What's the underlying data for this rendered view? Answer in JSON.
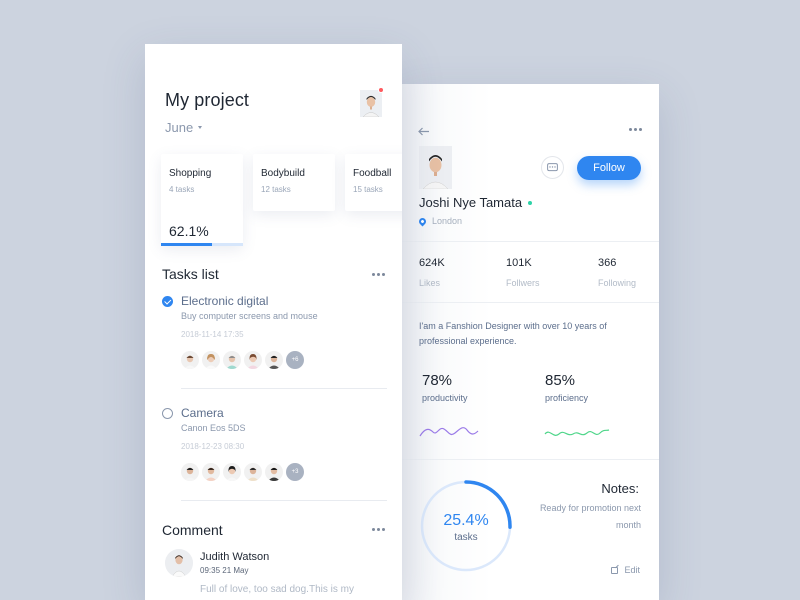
{
  "project": {
    "title": "My project",
    "month": "June",
    "notification_color": "#ff5a5f"
  },
  "categories": [
    {
      "name": "Shopping",
      "count": "4 tasks",
      "percent_label": "62.1%",
      "progress": 0.621
    },
    {
      "name": "Bodybuild",
      "count": "12 tasks"
    },
    {
      "name": "Foodball",
      "count": "15 tasks"
    }
  ],
  "tasks_section": {
    "title": "Tasks list",
    "items": [
      {
        "title": "Electronic digital",
        "subtitle": "Buy computer screens and mouse",
        "date": "2018-11-14 17:35",
        "done": true,
        "extra": "+6"
      },
      {
        "title": "Camera",
        "subtitle": "Canon Eos 5DS",
        "date": "2018-12-23 08:30",
        "done": false,
        "extra": "+3"
      }
    ]
  },
  "comment_section": {
    "title": "Comment",
    "author": "Judith Watson",
    "time": "09:35  21 May",
    "text": "Full of love, too sad dog.This is my"
  },
  "profile": {
    "name": "Joshi Nye Tamata",
    "location": "London",
    "follow_label": "Follow",
    "stats": [
      {
        "value": "624K",
        "label": "Likes"
      },
      {
        "value": "101K",
        "label": "Follwers"
      },
      {
        "value": "366",
        "label": "Following"
      }
    ],
    "bio": "I'am a Fanshion Designer with over 10 years of professional experience.",
    "metrics": [
      {
        "value": "78%",
        "label": "productivity",
        "color": "#9b7be8"
      },
      {
        "value": "85%",
        "label": "proficiency",
        "color": "#4fd68a"
      }
    ],
    "ring": {
      "value_label": "25.4%",
      "label": "tasks",
      "fraction": 0.254
    },
    "notes_title": "Notes:",
    "notes_text": "Ready for promotion next month",
    "edit_label": "Edit"
  },
  "colors": {
    "accent": "#2f86f0",
    "online": "#2ed3a8",
    "background": "#ccd3df"
  },
  "icons": {
    "back": "arrow-left-icon",
    "more": "more-dots-icon",
    "message": "message-icon",
    "location": "location-pin-icon",
    "check": "check-circle-icon",
    "edit": "edit-icon"
  }
}
